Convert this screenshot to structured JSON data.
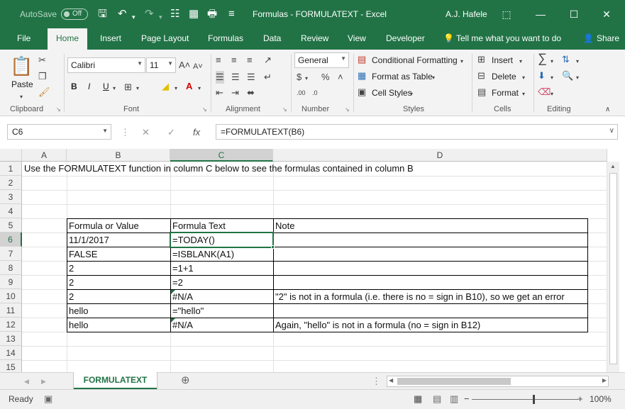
{
  "titlebar": {
    "autosave_label": "AutoSave",
    "autosave_state": "Off",
    "title": "Formulas - FORMULATEXT  -  Excel",
    "user": "A.J. Hafele"
  },
  "tabs": [
    "File",
    "Home",
    "Insert",
    "Page Layout",
    "Formulas",
    "Data",
    "Review",
    "View",
    "Developer"
  ],
  "tell_me": "Tell me what you want to do",
  "share": "Share",
  "ribbon": {
    "clipboard": {
      "label": "Clipboard",
      "paste": "Paste"
    },
    "font": {
      "label": "Font",
      "name": "Calibri",
      "size": "11",
      "bold": "B",
      "italic": "I",
      "underline": "U"
    },
    "alignment": {
      "label": "Alignment"
    },
    "number": {
      "label": "Number",
      "format": "General"
    },
    "styles": {
      "label": "Styles",
      "conditional": "Conditional Formatting",
      "format_table": "Format as Table",
      "cell_styles": "Cell Styles"
    },
    "cells": {
      "label": "Cells",
      "insert": "Insert",
      "delete": "Delete",
      "format": "Format"
    },
    "editing": {
      "label": "Editing"
    }
  },
  "formula_bar": {
    "name_box": "C6",
    "formula": "=FORMULATEXT(B6)",
    "fx": "fx"
  },
  "columns": [
    "A",
    "B",
    "C",
    "D"
  ],
  "rows": [
    "1",
    "2",
    "3",
    "4",
    "5",
    "6",
    "7",
    "8",
    "9",
    "10",
    "11",
    "12",
    "13",
    "14",
    "15"
  ],
  "cells": {
    "a1": "Use the FORMULATEXT function in column C below to see the formulas contained in column B",
    "table_header": [
      "Formula or Value",
      "Formula Text",
      "Note"
    ],
    "table_rows": [
      [
        "11/1/2017",
        "=TODAY()",
        ""
      ],
      [
        "FALSE",
        "=ISBLANK(A1)",
        ""
      ],
      [
        "2",
        "=1+1",
        ""
      ],
      [
        "2",
        "=2",
        ""
      ],
      [
        "2",
        "#N/A",
        "\"2\" is not in a formula (i.e. there is no = sign in B10), so we get an error"
      ],
      [
        "hello",
        "=\"hello\"",
        ""
      ],
      [
        "hello",
        "#N/A",
        "Again, \"hello\" is not in a formula (no = sign in B12)"
      ]
    ]
  },
  "sheet_tab": "FORMULATEXT",
  "status": {
    "ready": "Ready",
    "zoom": "100%"
  },
  "colors": {
    "accent": "#217346"
  }
}
